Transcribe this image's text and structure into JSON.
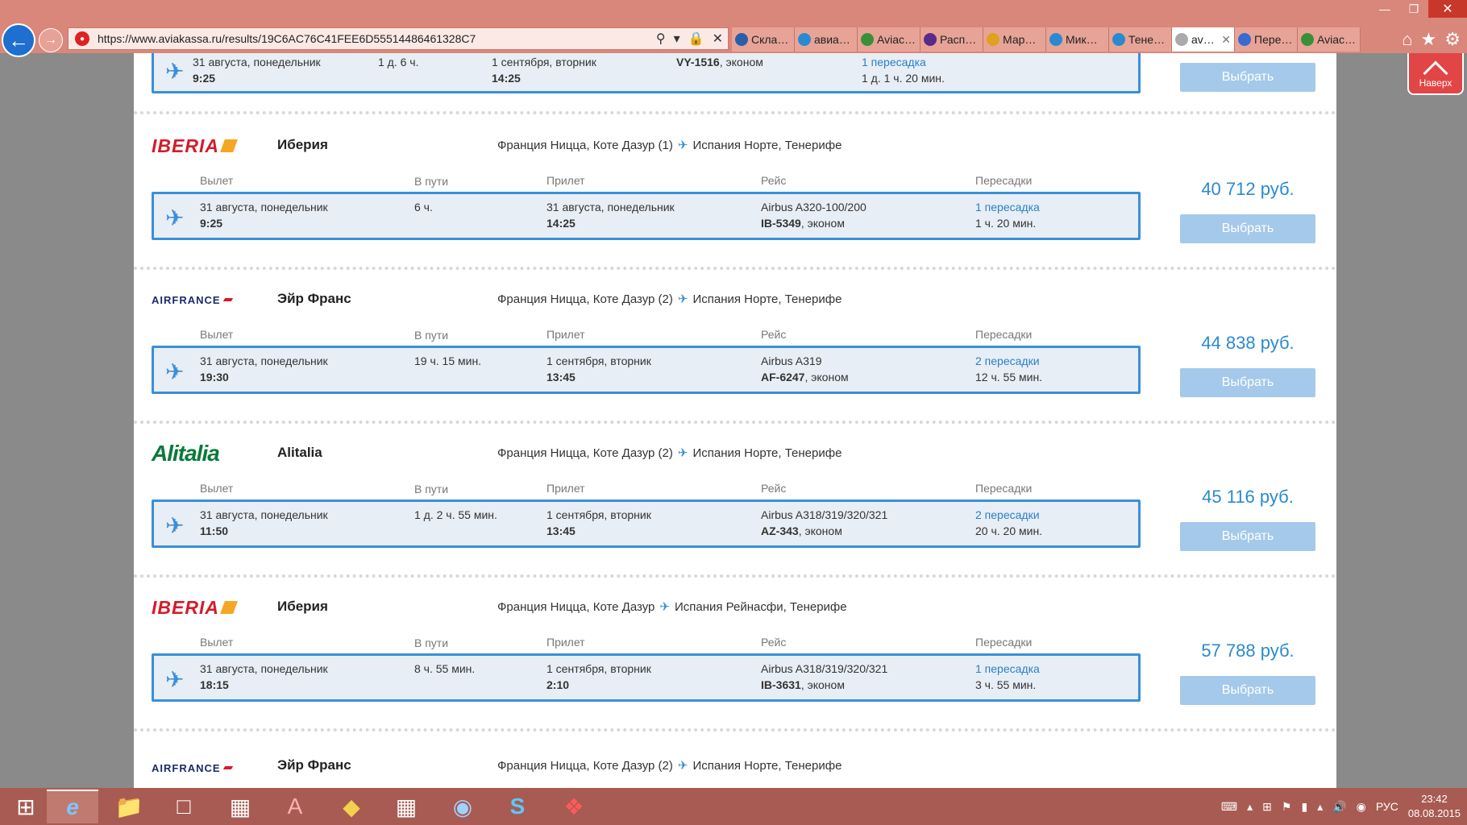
{
  "browser": {
    "url": "https://www.aviakassa.ru/results/19C6AC76C41FEE6D55514486461328C7",
    "tabs": [
      {
        "label": "Скла…",
        "color": "#2a5ea8"
      },
      {
        "label": "авиа…",
        "color": "#2a8ad0"
      },
      {
        "label": "Aviac…",
        "color": "#3a8f3a"
      },
      {
        "label": "Расп…",
        "color": "#5a2a8a"
      },
      {
        "label": "Мар…",
        "color": "#e0a020"
      },
      {
        "label": "Мик…",
        "color": "#2a8ad0"
      },
      {
        "label": "Тене…",
        "color": "#2a8ad0"
      },
      {
        "label": "av…",
        "color": "#aaaaaa"
      },
      {
        "label": "Пере…",
        "color": "#3a6ad0"
      },
      {
        "label": "Aviac…",
        "color": "#3a8f3a"
      }
    ]
  },
  "to_top_label": "Наверх",
  "headers": {
    "departure": "Вылет",
    "duration": "В пути",
    "arrival": "Прилет",
    "flight": "Рейс",
    "transfers": "Пересадки"
  },
  "select_label": "Выбрать",
  "top_partial": {
    "dep_date": "31 августа, понедельник",
    "dep_time": "9:25",
    "duration": "1 д. 6 ч.",
    "arr_date": "1 сентября, вторник",
    "arr_time": "14:25",
    "aircraft": "",
    "flight_no": "VY-1516",
    "class": ", эконом",
    "transfers": "1 пересадка",
    "transfer_time": "1 д. 1 ч. 20 мин."
  },
  "results": [
    {
      "logo": "IBERIA",
      "logo_type": "iberia",
      "airline": "Иберия",
      "route_from": "Франция Ницца, Коте Дазур (1)",
      "route_to": "Испания Норте, Тенерифе",
      "dep_date": "31 августа, понедельник",
      "dep_time": "9:25",
      "duration": "6 ч.",
      "arr_date": "31 августа, понедельник",
      "arr_time": "14:25",
      "aircraft": "Airbus A320-100/200",
      "flight_no": "IB-5349",
      "class": ", эконом",
      "transfers": "1 пересадка",
      "transfer_time": "1 ч. 20 мин.",
      "price": "40 712 руб."
    },
    {
      "logo": "AIRFRANCE",
      "logo_type": "airfrance",
      "airline": "Эйр Франс",
      "route_from": "Франция Ницца, Коте Дазур (2)",
      "route_to": "Испания Норте, Тенерифе",
      "dep_date": "31 августа, понедельник",
      "dep_time": "19:30",
      "duration": "19 ч. 15 мин.",
      "arr_date": "1 сентября, вторник",
      "arr_time": "13:45",
      "aircraft": "Airbus A319",
      "flight_no": "AF-6247",
      "class": ", эконом",
      "transfers": "2 пересадки",
      "transfer_time": "12 ч. 55 мин.",
      "price": "44 838 руб."
    },
    {
      "logo": "Alitalia",
      "logo_type": "alitalia",
      "airline": "Alitalia",
      "route_from": "Франция Ницца, Коте Дазур (2)",
      "route_to": "Испания Норте, Тенерифе",
      "dep_date": "31 августа, понедельник",
      "dep_time": "11:50",
      "duration": "1 д. 2 ч. 55 мин.",
      "arr_date": "1 сентября, вторник",
      "arr_time": "13:45",
      "aircraft": "Airbus A318/319/320/321",
      "flight_no": "AZ-343",
      "class": ", эконом",
      "transfers": "2 пересадки",
      "transfer_time": "20 ч. 20 мин.",
      "price": "45 116 руб."
    },
    {
      "logo": "IBERIA",
      "logo_type": "iberia",
      "airline": "Иберия",
      "route_from": "Франция Ницца, Коте Дазур",
      "route_to": "Испания Рейнасфи, Тенерифе",
      "dep_date": "31 августа, понедельник",
      "dep_time": "18:15",
      "duration": "8 ч. 55 мин.",
      "arr_date": "1 сентября, вторник",
      "arr_time": "2:10",
      "aircraft": "Airbus A318/319/320/321",
      "flight_no": "IB-3631",
      "class": ", эконом",
      "transfers": "1 пересадка",
      "transfer_time": "3 ч. 55 мин.",
      "price": "57 788 руб."
    }
  ],
  "bottom_partial": {
    "logo": "AIRFRANCE",
    "airline": "Эйр Франс",
    "route_from": "Франция Ницца, Коте Дазур (2)",
    "route_to": "Испания Норте, Тенерифе"
  },
  "taskbar": {
    "lang": "РУС",
    "time": "23:42",
    "date": "08.08.2015"
  }
}
